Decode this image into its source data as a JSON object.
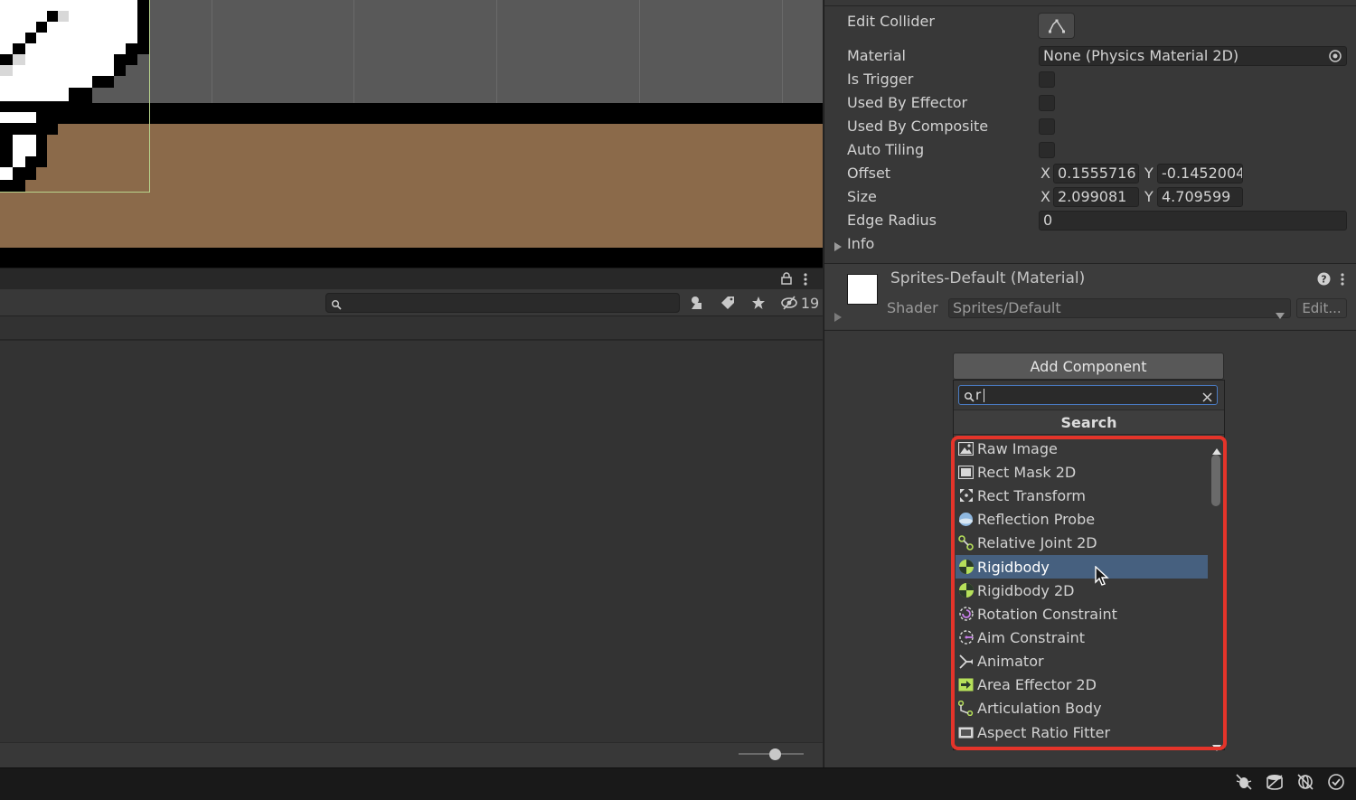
{
  "inspector": {
    "edit_collider_label": "Edit Collider",
    "material_label": "Material",
    "material_value": "None (Physics Material 2D)",
    "is_trigger_label": "Is Trigger",
    "used_by_effector_label": "Used By Effector",
    "used_by_composite_label": "Used By Composite",
    "auto_tiling_label": "Auto Tiling",
    "offset_label": "Offset",
    "offset_x_axis": "X",
    "offset_x": "0.1555716",
    "offset_y_axis": "Y",
    "offset_y": "-0.1452004",
    "size_label": "Size",
    "size_x_axis": "X",
    "size_x": "2.099081",
    "size_y_axis": "Y",
    "size_y": "4.709599",
    "edge_radius_label": "Edge Radius",
    "edge_radius_value": "0",
    "info_label": "Info",
    "material_component_title": "Sprites-Default (Material)",
    "shader_label": "Shader",
    "shader_value": "Sprites/Default",
    "shader_edit_label": "Edit..."
  },
  "project": {
    "hidden_count": "19"
  },
  "add_component": {
    "button_label": "Add Component",
    "search_value": "r",
    "section_title": "Search",
    "items": [
      {
        "label": "Raw Image",
        "icon": "raw-image-icon"
      },
      {
        "label": "Rect Mask 2D",
        "icon": "rect-mask-icon"
      },
      {
        "label": "Rect Transform",
        "icon": "rect-transform-icon"
      },
      {
        "label": "Reflection Probe",
        "icon": "reflection-probe-icon"
      },
      {
        "label": "Relative Joint 2D",
        "icon": "relative-joint-icon"
      },
      {
        "label": "Rigidbody",
        "icon": "rigidbody-icon",
        "selected": true
      },
      {
        "label": "Rigidbody 2D",
        "icon": "rigidbody-2d-icon"
      },
      {
        "label": "Rotation Constraint",
        "icon": "rotation-constraint-icon"
      },
      {
        "label": "Aim Constraint",
        "icon": "aim-constraint-icon"
      },
      {
        "label": "Animator",
        "icon": "animator-icon"
      },
      {
        "label": "Area Effector 2D",
        "icon": "area-effector-icon"
      },
      {
        "label": "Articulation Body",
        "icon": "articulation-body-icon"
      },
      {
        "label": "Aspect Ratio Fitter",
        "icon": "aspect-ratio-fitter-icon"
      }
    ]
  },
  "colors": {
    "highlight": "#e4342a",
    "selection": "#46607f",
    "ground": "#8b6a4a",
    "rigidbody_green": "#b6e05a"
  }
}
